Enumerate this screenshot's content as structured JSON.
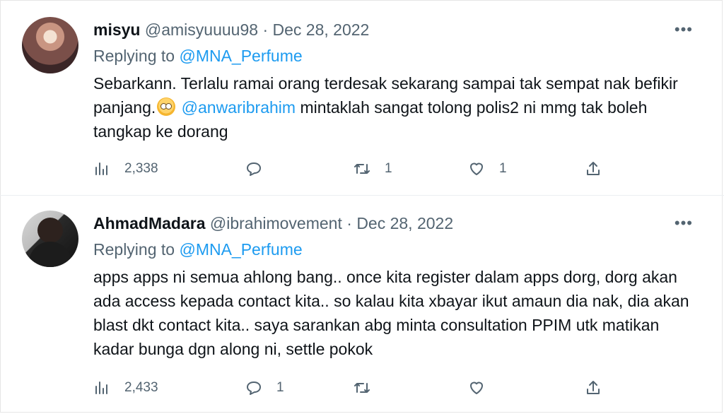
{
  "tweets": [
    {
      "name": "misyu",
      "handle": "@amisyuuuu98",
      "date": "Dec 28, 2022",
      "replying_prefix": "Replying to",
      "replying_to": "@MNA_Perfume",
      "body_part1": "Sebarkann. Terlalu ramai orang terdesak sekarang sampai tak sempat nak befikir panjang.",
      "emoji": "face-holding-back-tears",
      "body_mention": "@anwaribrahim",
      "body_part2": "mintaklah sangat tolong polis2 ni mmg tak boleh tangkap ke dorang",
      "views": "2,338",
      "replies": "",
      "retweets": "1",
      "likes": "1"
    },
    {
      "name": "AhmadMadara",
      "handle": "@ibrahimovement",
      "date": "Dec 28, 2022",
      "replying_prefix": "Replying to",
      "replying_to": "@MNA_Perfume",
      "body": "apps apps ni semua ahlong bang.. once kita register dalam apps dorg, dorg akan ada access kepada contact kita.. so kalau kita xbayar ikut amaun dia nak, dia akan blast dkt contact kita.. saya sarankan abg minta consultation PPIM utk matikan kadar bunga dgn along ni, settle pokok",
      "views": "2,433",
      "replies": "1",
      "retweets": "",
      "likes": ""
    }
  ],
  "separator": "·",
  "more_label": "•••",
  "colors": {
    "link": "#1d9bf0",
    "muted": "#536471",
    "text": "#0f1419"
  },
  "icons": [
    "views-icon",
    "reply-icon",
    "retweet-icon",
    "like-icon",
    "share-icon",
    "more-icon"
  ]
}
